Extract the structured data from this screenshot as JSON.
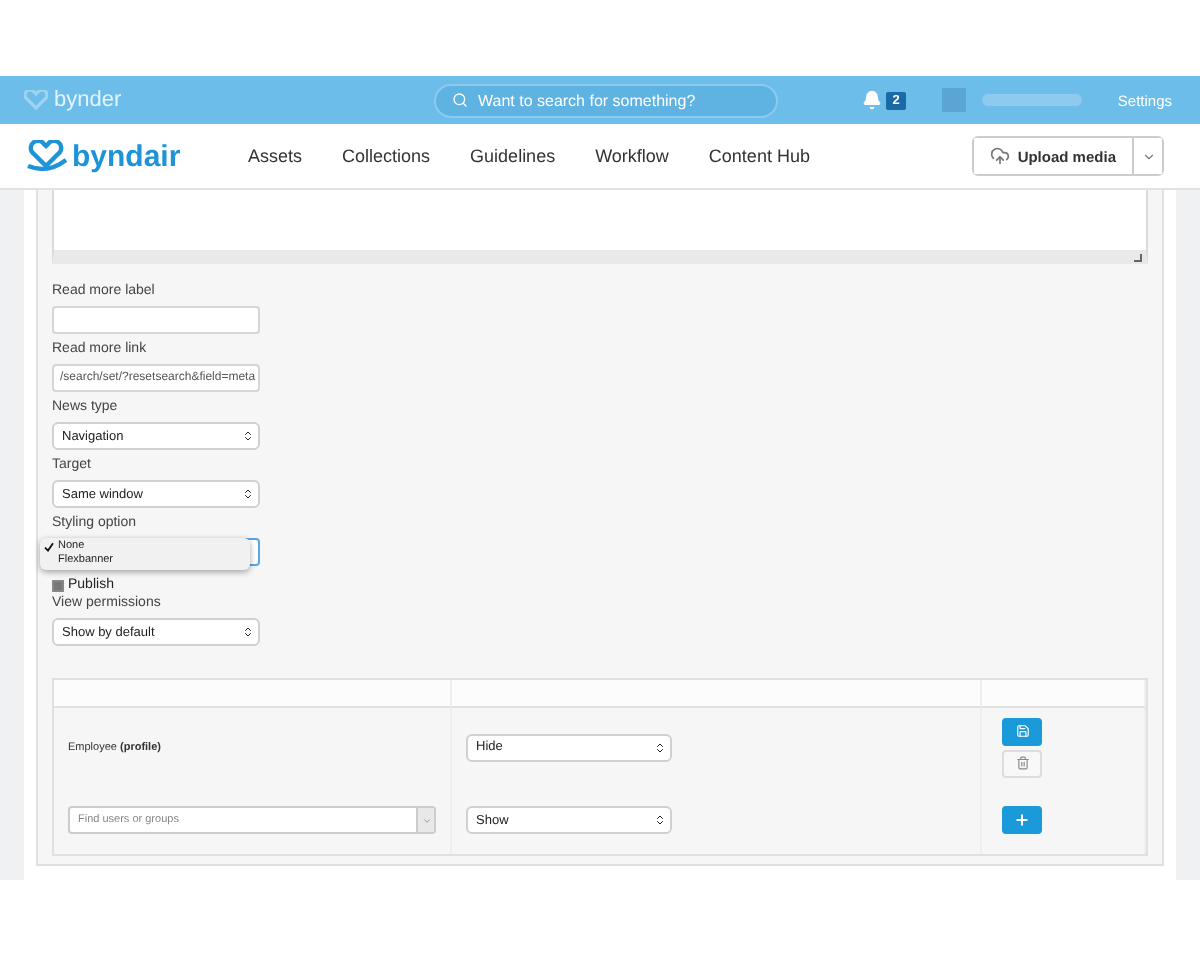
{
  "topbar": {
    "logo": "bynder",
    "search": {
      "placeholder": "Want to search for something?"
    },
    "notifications": "2",
    "settings": "Settings"
  },
  "nav": {
    "logo": "byndair",
    "items": [
      "Assets",
      "Collections",
      "Guidelines",
      "Workflow",
      "Content Hub"
    ],
    "upload": "Upload media"
  },
  "form": [
    {
      "kind": "text",
      "label": "Read more label"
    },
    {
      "kind": "text",
      "label": "Read more link",
      "value": "/search/set/?resetsearch&field=meta"
    },
    {
      "kind": "select",
      "label": "News type",
      "value": "Navigation"
    },
    {
      "kind": "select",
      "label": "Target",
      "value": "Same window"
    },
    {
      "kind": "open-select",
      "label": "Styling option",
      "options": [
        {
          "label": "None",
          "selected": true
        },
        {
          "label": "Flexbanner",
          "selected": false
        }
      ]
    },
    {
      "kind": "checkbox",
      "label": "Publish",
      "checked": true
    },
    {
      "kind": "select",
      "label": "View permissions",
      "value": "Show by default"
    }
  ],
  "permissions": {
    "rows": [
      {
        "kind": "entry",
        "who": "Employee **(profile)**",
        "visibility": "Hide"
      },
      {
        "kind": "new",
        "placeholder": "Find users or groups",
        "visibility": "Show"
      }
    ]
  }
}
